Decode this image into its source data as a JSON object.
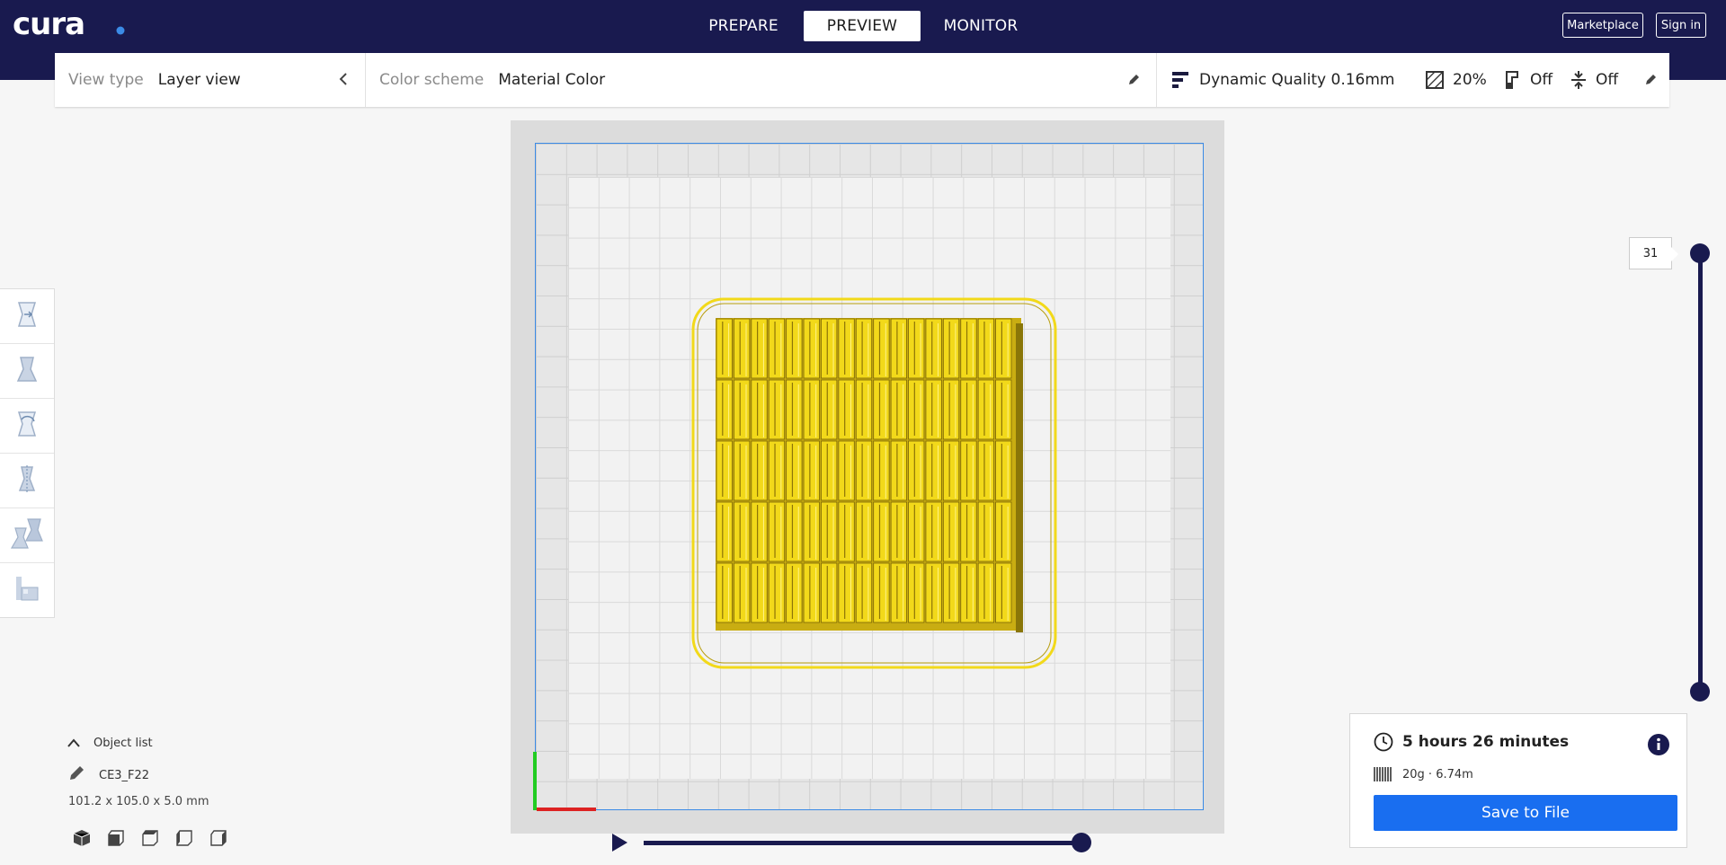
{
  "app": {
    "logo": "cura."
  },
  "header": {
    "tabs": [
      {
        "label": "PREPARE",
        "active": false
      },
      {
        "label": "PREVIEW",
        "active": true
      },
      {
        "label": "MONITOR",
        "active": false
      }
    ],
    "marketplace_label": "Marketplace",
    "signin_label": "Sign in"
  },
  "settings_bar": {
    "view_type_label": "View type",
    "view_type_value": "Layer view",
    "color_scheme_label": "Color scheme",
    "color_scheme_value": "Material Color",
    "profile": "Dynamic Quality 0.16mm",
    "infill": "20%",
    "support": "Off",
    "adhesion": "Off"
  },
  "layer_slider": {
    "current_layer": "31"
  },
  "object_list": {
    "toggle_label": "Object list",
    "object_name": "CE3_F22",
    "dimensions": "101.2 x 105.0 x 5.0 mm"
  },
  "print_info": {
    "time": "5 hours 26 minutes",
    "material": "20g · 6.74m",
    "save_label": "Save to File"
  },
  "colors": {
    "header_bg": "#191a4f",
    "accent_blue": "#196ef0",
    "material_yellow": "#f2d91a",
    "build_plate_border": "#3b8be6"
  }
}
